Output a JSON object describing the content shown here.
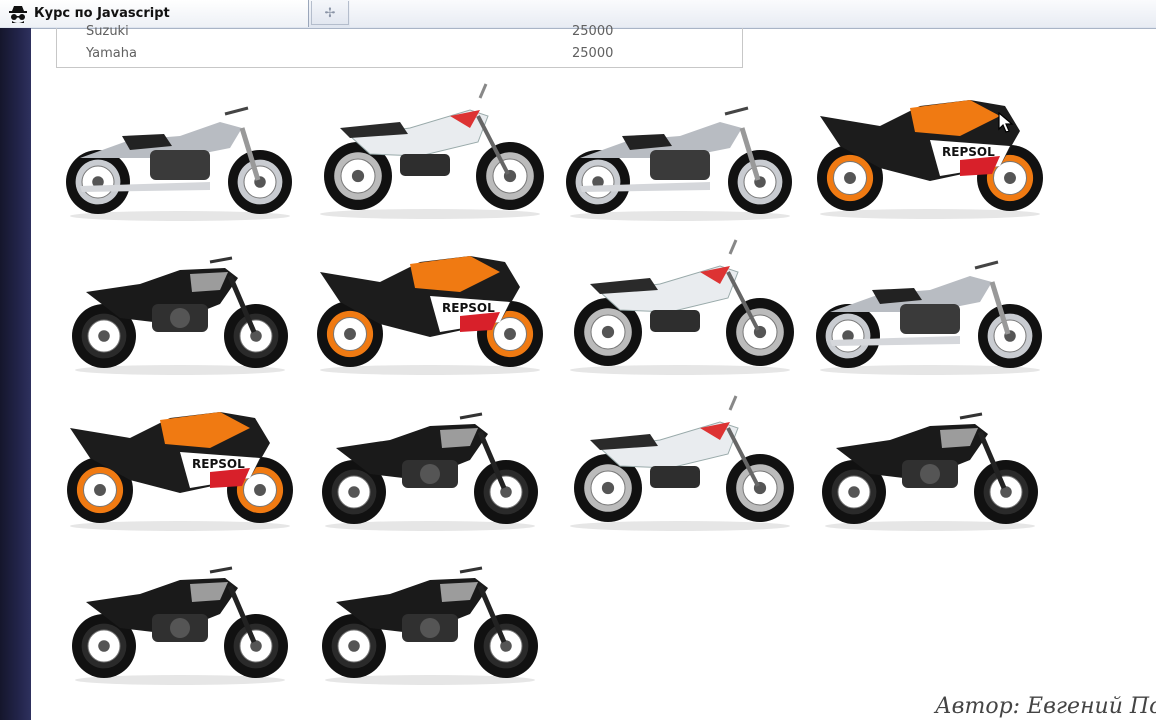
{
  "browser": {
    "tab_title": "Курс по Javascript",
    "tab_icon": "spy-icon",
    "new_tab_icon": "plus-icon"
  },
  "price_table": {
    "rows": [
      {
        "name": "Suzuki",
        "price": "25000"
      },
      {
        "name": "Yamaha",
        "price": "25000"
      }
    ]
  },
  "gallery": {
    "items": [
      {
        "model": "cruiser"
      },
      {
        "model": "adventure"
      },
      {
        "model": "cruiser"
      },
      {
        "model": "sportbike"
      },
      {
        "model": "naked"
      },
      {
        "model": "sportbike"
      },
      {
        "model": "adventure"
      },
      {
        "model": "cruiser"
      },
      {
        "model": "sportbike"
      },
      {
        "model": "naked"
      },
      {
        "model": "adventure"
      },
      {
        "model": "naked"
      },
      {
        "model": "naked"
      },
      {
        "model": "naked"
      }
    ]
  },
  "footer": {
    "author": "Автор: Евгений Попов"
  },
  "colors": {
    "sport_orange": "#f07a12",
    "sport_red": "#d8202a",
    "chrome": "#b8bcc2",
    "dark": "#1a1a1a",
    "white_fairing": "#e9ecef"
  }
}
